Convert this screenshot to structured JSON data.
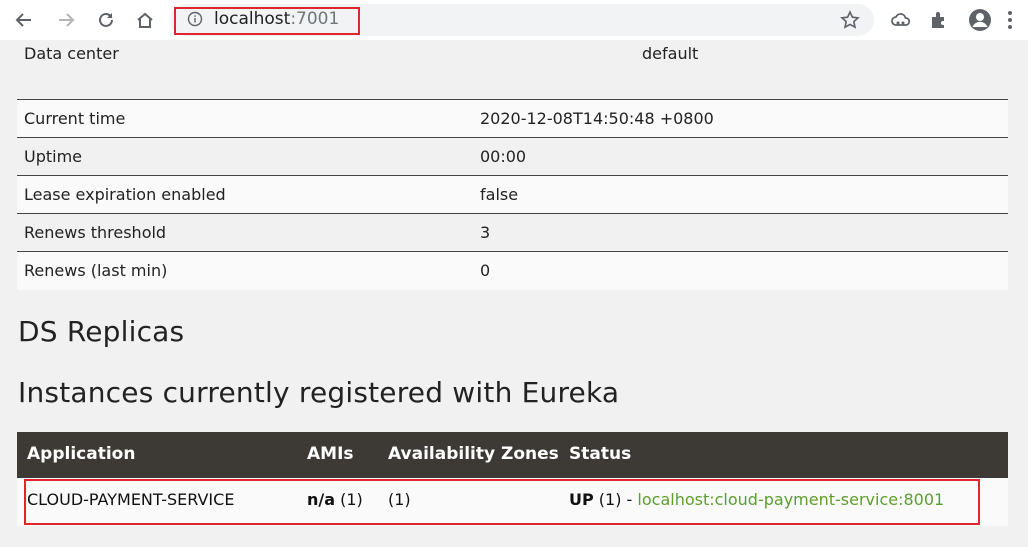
{
  "browser": {
    "url_host": "localhost",
    "url_port": ":7001",
    "icons": [
      "back-icon",
      "forward-icon",
      "reload-icon",
      "home-icon",
      "info-icon",
      "star-icon",
      "extension-cloud-icon",
      "puzzle-icon",
      "profile-icon",
      "menu-icon"
    ]
  },
  "data_center": {
    "label": "Data center",
    "value": "default"
  },
  "info_rows": [
    {
      "label": "Current time",
      "value": "2020-12-08T14:50:48 +0800"
    },
    {
      "label": "Uptime",
      "value": "00:00"
    },
    {
      "label": "Lease expiration enabled",
      "value": "false"
    },
    {
      "label": "Renews threshold",
      "value": "3"
    },
    {
      "label": "Renews (last min)",
      "value": "0"
    }
  ],
  "headings": {
    "replicas": "DS Replicas",
    "instances": "Instances currently registered with Eureka"
  },
  "instances": {
    "headers": {
      "application": "Application",
      "amis": "AMIs",
      "zones": "Availability Zones",
      "status": "Status"
    },
    "rows": [
      {
        "application": "CLOUD-PAYMENT-SERVICE",
        "ami_bold": "n/a",
        "ami_count": " (1)",
        "zones": "(1)",
        "status_bold": "UP",
        "status_count": " (1) - ",
        "instance_link": "localhost:cloud-payment-service:8001"
      }
    ]
  },
  "colors": {
    "header_bg": "#3d3a36",
    "link": "#5c9e2e",
    "highlight_border": "#e0262c"
  }
}
